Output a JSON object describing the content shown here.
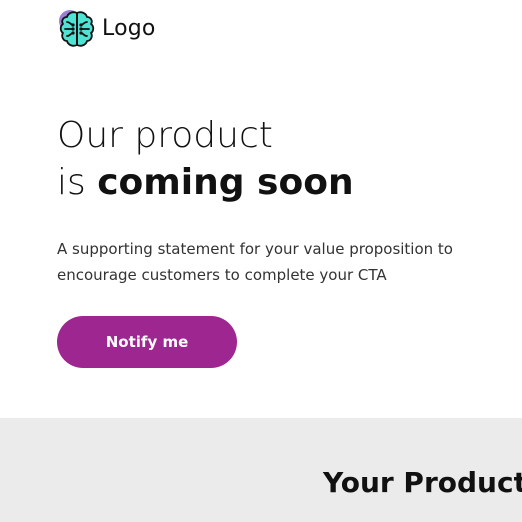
{
  "header": {
    "logo_text": "Logo",
    "logo_icon": "brain-icon"
  },
  "hero": {
    "headline_line1": "Our product",
    "headline_line2_prefix": "is ",
    "headline_line2_emphasis": "coming soon",
    "subtext": "A supporting statement for your value proposition to encourage customers to complete your CTA",
    "cta_label": "Notify me"
  },
  "product_section": {
    "title": "Your Product"
  },
  "colors": {
    "accent": "#9e2690",
    "brain_fill": "#4fe3d4",
    "logo_blob": "#9b7fd4",
    "band_background": "#ebebeb"
  }
}
